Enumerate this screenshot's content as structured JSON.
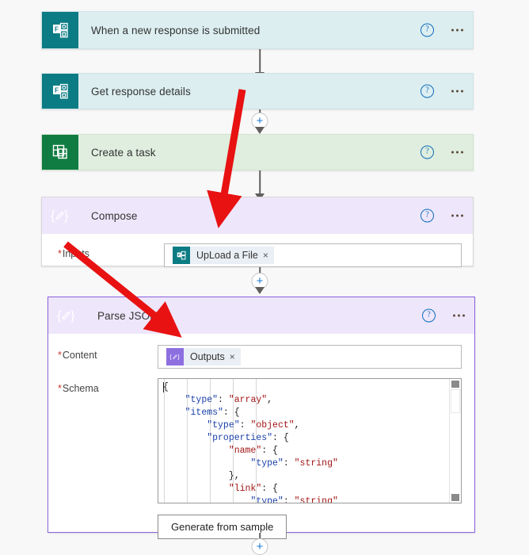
{
  "flow": {
    "steps": [
      {
        "id": "trigger-forms",
        "title": "When a new response is submitted",
        "icon": "microsoft-forms-icon",
        "theme": "teal",
        "help_label": "?",
        "menu_label": "•••"
      },
      {
        "id": "get-response-details",
        "title": "Get response details",
        "icon": "microsoft-forms-icon",
        "theme": "teal",
        "help_label": "?",
        "menu_label": "•••"
      },
      {
        "id": "create-a-task",
        "title": "Create a task",
        "icon": "microsoft-planner-icon",
        "theme": "green",
        "help_label": "?",
        "menu_label": "•••"
      },
      {
        "id": "compose",
        "title": "Compose",
        "icon": "compose-icon",
        "theme": "purple",
        "help_label": "?",
        "menu_label": "•••"
      },
      {
        "id": "parse-json",
        "title": "Parse JSON",
        "icon": "compose-icon",
        "theme": "purple",
        "selected": true,
        "help_label": "?",
        "menu_label": "•••"
      }
    ]
  },
  "compose": {
    "inputs_label": "Inputs",
    "required_mark": "*",
    "token": {
      "text": "UpLoad a File",
      "remove_label": "×",
      "icon": "microsoft-forms-icon"
    }
  },
  "parse_json": {
    "content_label": "Content",
    "schema_label": "Schema",
    "required_mark": "*",
    "content_token": {
      "text": "Outputs",
      "remove_label": "×",
      "icon": "compose-icon"
    },
    "schema_lines": [
      {
        "indent": 0,
        "parts": [
          {
            "t": "{",
            "c": "g"
          }
        ]
      },
      {
        "indent": 1,
        "parts": [
          {
            "t": "\"type\"",
            "c": "k"
          },
          {
            "t": ": ",
            "c": "g"
          },
          {
            "t": "\"array\"",
            "c": "s"
          },
          {
            "t": ",",
            "c": "g"
          }
        ]
      },
      {
        "indent": 1,
        "parts": [
          {
            "t": "\"items\"",
            "c": "k"
          },
          {
            "t": ": {",
            "c": "g"
          }
        ]
      },
      {
        "indent": 2,
        "parts": [
          {
            "t": "\"type\"",
            "c": "k"
          },
          {
            "t": ": ",
            "c": "g"
          },
          {
            "t": "\"object\"",
            "c": "s"
          },
          {
            "t": ",",
            "c": "g"
          }
        ]
      },
      {
        "indent": 2,
        "parts": [
          {
            "t": "\"properties\"",
            "c": "k"
          },
          {
            "t": ": {",
            "c": "g"
          }
        ]
      },
      {
        "indent": 3,
        "parts": [
          {
            "t": "\"name\"",
            "c": "p"
          },
          {
            "t": ": {",
            "c": "g"
          }
        ]
      },
      {
        "indent": 4,
        "parts": [
          {
            "t": "\"type\"",
            "c": "k"
          },
          {
            "t": ": ",
            "c": "g"
          },
          {
            "t": "\"string\"",
            "c": "s"
          }
        ]
      },
      {
        "indent": 3,
        "parts": [
          {
            "t": "},",
            "c": "g"
          }
        ]
      },
      {
        "indent": 3,
        "parts": [
          {
            "t": "\"link\"",
            "c": "p"
          },
          {
            "t": ": {",
            "c": "g"
          }
        ]
      },
      {
        "indent": 4,
        "parts": [
          {
            "t": "\"type\"",
            "c": "k"
          },
          {
            "t": ": ",
            "c": "g"
          },
          {
            "t": "\"string\"",
            "c": "s"
          }
        ]
      }
    ],
    "generate_button_label": "Generate from sample"
  },
  "connectors": {
    "add_label": "+"
  },
  "colors": {
    "forms_teal": "#0c7c84",
    "planner_green": "#107c41",
    "compose_purple": "#8e6fe0",
    "selected_border": "#8a63e0",
    "required_red": "#c7372f",
    "annotation_red": "#e81212",
    "link_blue": "#0f6cbd"
  }
}
